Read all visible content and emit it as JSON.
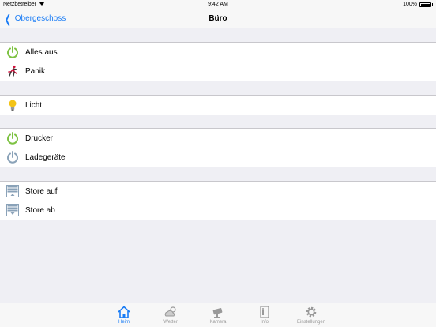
{
  "status": {
    "carrier": "Netzbetreiber",
    "time": "9:42 AM",
    "battery": "100%"
  },
  "nav": {
    "back_label": "Obergeschoss",
    "title": "Büro"
  },
  "groups": [
    {
      "items": [
        {
          "label": "Alles aus",
          "icon": "power-icon",
          "color": "#7dc242"
        },
        {
          "label": "Panik",
          "icon": "running-person-icon",
          "color": "#d0103a"
        }
      ]
    },
    {
      "items": [
        {
          "label": "Licht",
          "icon": "lightbulb-icon",
          "color": "#f3c316"
        }
      ]
    },
    {
      "items": [
        {
          "label": "Drucker",
          "icon": "power-icon",
          "color": "#7dc242"
        },
        {
          "label": "Ladegeräte",
          "icon": "power-icon",
          "color": "#8aa2b8"
        }
      ]
    },
    {
      "items": [
        {
          "label": "Store auf",
          "icon": "blind-up-icon",
          "color": "#8aa2b8"
        },
        {
          "label": "Store ab",
          "icon": "blind-down-icon",
          "color": "#8aa2b8"
        }
      ]
    }
  ],
  "tabs": [
    {
      "label": "Heim",
      "icon": "home-icon",
      "active": true
    },
    {
      "label": "Wetter",
      "icon": "weather-icon",
      "active": false
    },
    {
      "label": "Kamera",
      "icon": "camera-icon",
      "active": false
    },
    {
      "label": "Info",
      "icon": "info-icon",
      "active": false
    },
    {
      "label": "Einstellungen",
      "icon": "gear-icon",
      "active": false
    }
  ],
  "colors": {
    "accent": "#1a7cf5",
    "inactive": "#999999"
  }
}
